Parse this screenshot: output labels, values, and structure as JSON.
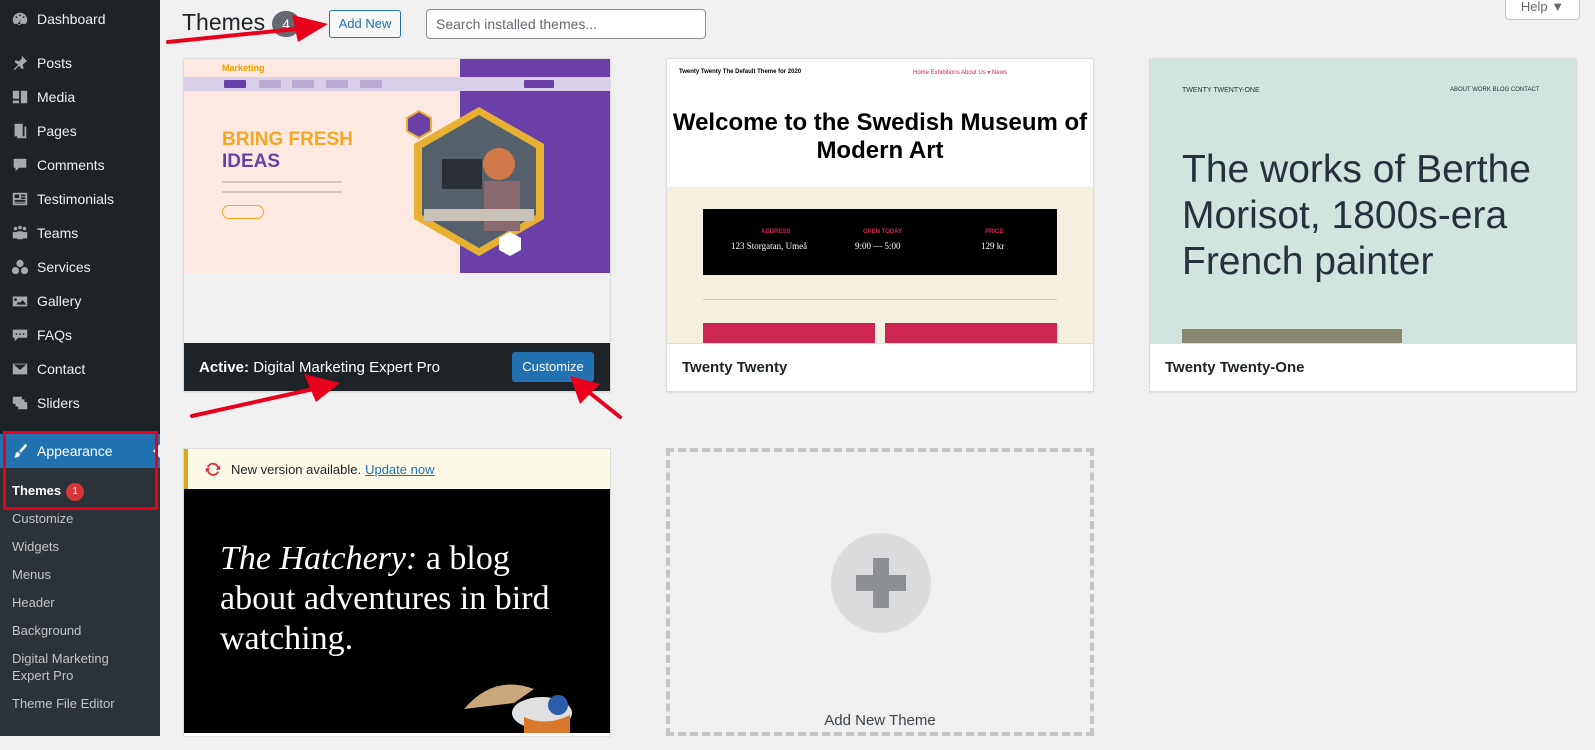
{
  "sidebar": {
    "items": [
      {
        "label": "Dashboard",
        "icon": "dashboard-icon"
      },
      {
        "label": "Posts",
        "icon": "pushpin-icon"
      },
      {
        "label": "Media",
        "icon": "media-icon"
      },
      {
        "label": "Pages",
        "icon": "pages-icon"
      },
      {
        "label": "Comments",
        "icon": "comments-icon"
      },
      {
        "label": "Testimonials",
        "icon": "testimonials-icon"
      },
      {
        "label": "Teams",
        "icon": "teams-icon"
      },
      {
        "label": "Services",
        "icon": "services-icon"
      },
      {
        "label": "Gallery",
        "icon": "gallery-icon"
      },
      {
        "label": "FAQs",
        "icon": "faqs-icon"
      },
      {
        "label": "Contact",
        "icon": "mail-icon"
      },
      {
        "label": "Sliders",
        "icon": "sliders-icon"
      },
      {
        "label": "Appearance",
        "icon": "paintbrush-icon"
      }
    ],
    "submenu": {
      "themes_label": "Themes",
      "themes_badge": "1",
      "items": [
        "Customize",
        "Widgets",
        "Menus",
        "Header",
        "Background",
        "Digital Marketing Expert Pro",
        "Theme File Editor"
      ]
    }
  },
  "header": {
    "title": "Themes",
    "count": "4",
    "add_new_label": "Add New",
    "search_placeholder": "Search installed themes...",
    "help_label": "Help ▼"
  },
  "themes": {
    "active": {
      "active_prefix": "Active:",
      "name": "Digital Marketing Expert Pro",
      "customize_label": "Customize",
      "shot_brand": "Marketing",
      "shot_heading_1": "BRING FRESH",
      "shot_heading_2": "IDEAS"
    },
    "twenty_twenty": {
      "name": "Twenty Twenty",
      "shot_nav_left": "Twenty Twenty   The Default Theme for 2020",
      "shot_nav_right": "Home   Exhibitions   About Us ▾   News",
      "shot_heading": "Welcome to the Swedish Museum of Modern Art",
      "shot_address_label": "ADDRESS",
      "shot_address": "123 Storgatan, Umeå",
      "shot_open_label": "OPEN TODAY",
      "shot_open": "9:00 — 5:00",
      "shot_price_label": "PRICE",
      "shot_price": "129 kr"
    },
    "twenty_twenty_one": {
      "name": "Twenty Twenty-One",
      "shot_site": "TWENTY TWENTY-ONE",
      "shot_nav": "ABOUT   WORK   BLOG   CONTACT",
      "shot_heading": "The works of Berthe Morisot, 1800s-era French painter"
    },
    "hatchery": {
      "notice_text": "New version available.",
      "notice_link": "Update now",
      "shot_title_italic": "The Hatchery:",
      "shot_title_rest": " a blog about adventures in bird watching."
    },
    "add_new_theme_label": "Add New Theme"
  },
  "colors": {
    "accent": "#2271b1",
    "annotation": "#e8001c",
    "sidebar": "#1d2327"
  }
}
